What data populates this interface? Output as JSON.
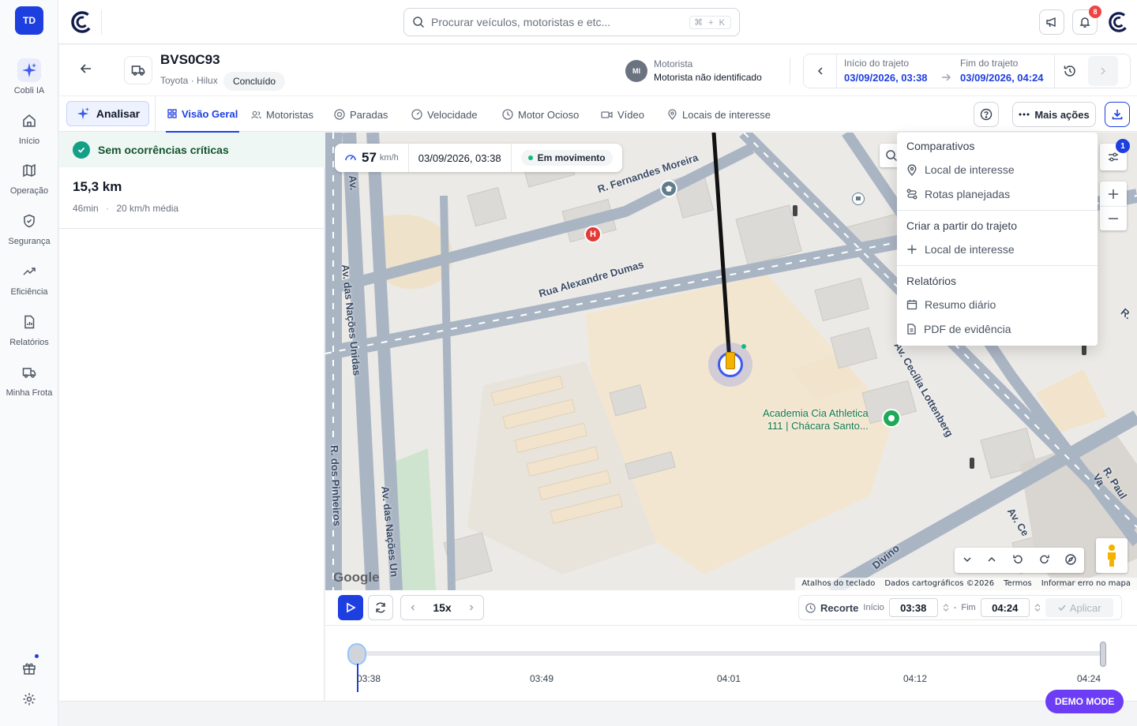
{
  "user": {
    "initials": "TD"
  },
  "sidebar": {
    "items": [
      {
        "label": "Cobli IA",
        "icon": "sparkle-icon"
      },
      {
        "label": "Início",
        "icon": "home-icon"
      },
      {
        "label": "Operação",
        "icon": "map-icon"
      },
      {
        "label": "Segurança",
        "icon": "shield-icon"
      },
      {
        "label": "Eficiência",
        "icon": "trend-icon"
      },
      {
        "label": "Relatórios",
        "icon": "report-icon"
      },
      {
        "label": "Minha Frota",
        "icon": "truck-icon"
      }
    ]
  },
  "topbar": {
    "search_placeholder": "Procurar veículos, motoristas e etc...",
    "search_shortcut": "⌘ + K",
    "notification_count": "8"
  },
  "vehicle": {
    "plate": "BVS0C93",
    "model": "Toyota · Hilux",
    "status": "Concluído"
  },
  "driver": {
    "initials": "MI",
    "label": "Motorista",
    "name": "Motorista não identificado"
  },
  "trip": {
    "start_label": "Início do trajeto",
    "start_value": "03/09/2026, 03:38",
    "end_label": "Fim do trajeto",
    "end_value": "03/09/2026, 04:24"
  },
  "tabs": {
    "analyze_label": "Analisar",
    "items": [
      {
        "label": "Visão Geral",
        "icon": "grid-icon"
      },
      {
        "label": "Motoristas",
        "icon": "users-icon"
      },
      {
        "label": "Paradas",
        "icon": "stop-icon"
      },
      {
        "label": "Velocidade",
        "icon": "gauge-icon"
      },
      {
        "label": "Motor Ocioso",
        "icon": "clock-icon"
      },
      {
        "label": "Vídeo",
        "icon": "camera-icon"
      },
      {
        "label": "Locais de interesse",
        "icon": "pin-icon"
      }
    ],
    "more_label": "Mais ações"
  },
  "summary": {
    "critical_text": "Sem ocorrências críticas",
    "distance": "15,3 km",
    "duration": "46min",
    "avg_speed": "20 km/h média"
  },
  "map": {
    "speed_value": "57",
    "speed_unit": "km/h",
    "timestamp": "03/09/2026, 03:38",
    "motion_status": "Em movimento",
    "filter_badge": "1",
    "streets": [
      "R. Fernandes Moreira",
      "Rua Alexandre Dumas",
      "Av. das Nações Unidas",
      "Av. das Nações Un",
      "Av. Cecília Lottenberg",
      "R. Paul Va",
      "Av. Ce",
      "Divino",
      "Av.",
      "R.",
      "R. dos Pinheiros"
    ],
    "poi_line1": "Academia Cia Athletica",
    "poi_line2": "111 | Chácara Santo...",
    "google_logo": "Google",
    "attribution": [
      "Atalhos do teclado",
      "Dados cartográficos ©2026",
      "Termos",
      "Informar erro no mapa"
    ]
  },
  "menu": {
    "section1_title": "Comparativos",
    "section1_items": [
      "Local de interesse",
      "Rotas planejadas"
    ],
    "section2_title": "Criar a partir do trajeto",
    "section2_items": [
      "Local de interesse"
    ],
    "section3_title": "Relatórios",
    "section3_items": [
      "Resumo diário",
      "PDF de evidência"
    ]
  },
  "playback": {
    "speed": "15x",
    "crop_label": "Recorte",
    "start_label": "Início",
    "start_value": "03:38",
    "end_label": "Fim",
    "end_value": "04:24",
    "apply_label": "Aplicar",
    "progress": 0,
    "ticks": [
      "03:38",
      "03:49",
      "04:01",
      "04:12",
      "04:24"
    ]
  },
  "demo_label": "DEMO MODE",
  "colors": {
    "accent": "#1e3fe0",
    "success": "#14a085",
    "demo": "#6d3df5"
  }
}
